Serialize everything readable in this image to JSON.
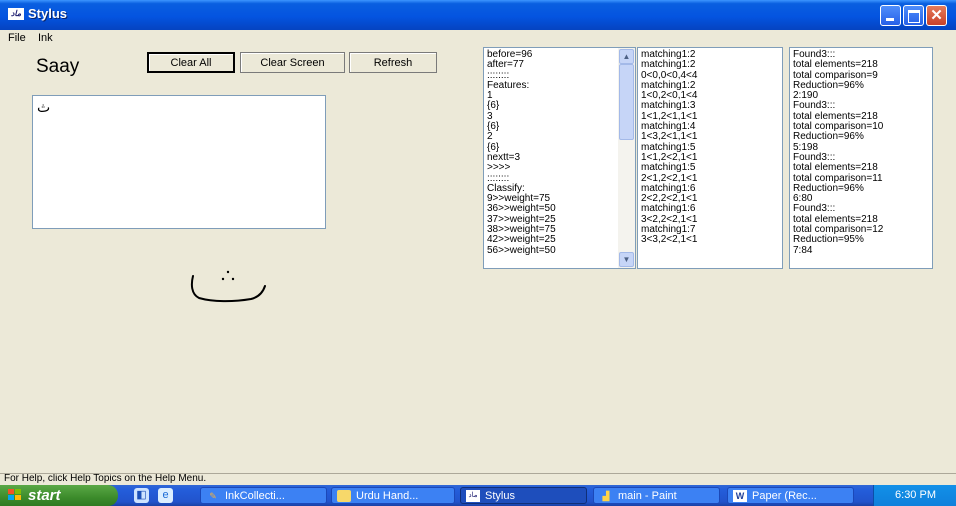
{
  "window": {
    "title": "Stylus",
    "icon_text": "ماد"
  },
  "menu": {
    "file": "File",
    "ink": "Ink"
  },
  "recognized_word": "Saay",
  "buttons": {
    "clear_all": "Clear All",
    "clear_screen": "Clear Screen",
    "refresh": "Refresh"
  },
  "canvas_glyph": "ث",
  "list1": {
    "lines": [
      "before=96",
      "after=77",
      "::::::::",
      "Features:",
      "1",
      "{6}",
      "3",
      "{6}",
      "2",
      "{6}",
      "nextt=3",
      ">>>>",
      "::::::::",
      "Classify:",
      "9>>weight=75",
      "36>>weight=50",
      "37>>weight=25",
      "38>>weight=75",
      "42>>weight=25",
      "56>>weight=50"
    ]
  },
  "list2": {
    "lines": [
      "matching1:2",
      "matching1:2",
      "0<0,0<0,4<4",
      "matching1:2",
      "1<0,2<0,1<4",
      "matching1:3",
      "1<1,2<1,1<1",
      "matching1:4",
      "1<3,2<1,1<1",
      "matching1:5",
      "1<1,2<2,1<1",
      "matching1:5",
      "2<1,2<2,1<1",
      "matching1:6",
      "2<2,2<2,1<1",
      "matching1:6",
      "3<2,2<2,1<1",
      "matching1:7",
      "3<3,2<2,1<1"
    ]
  },
  "list3": {
    "lines": [
      "Found3:::",
      "total elements=218",
      "total comparison=9",
      "Reduction=96%",
      "2:190",
      "Found3:::",
      "total elements=218",
      "total comparison=10",
      "Reduction=96%",
      "5:198",
      "Found3:::",
      "total elements=218",
      "total comparison=11",
      "Reduction=96%",
      "6:80",
      "Found3:::",
      "total elements=218",
      "total comparison=12",
      "Reduction=95%",
      "7:84"
    ]
  },
  "status_text": "For Help, click Help Topics on the Help Menu.",
  "taskbar": {
    "start": "start",
    "tasks": [
      {
        "label": "InkCollecti...",
        "icon": "ink-icon"
      },
      {
        "label": "Urdu Hand...",
        "icon": "folder-icon"
      },
      {
        "label": "Stylus",
        "icon": "stylus-app-icon",
        "active": true
      },
      {
        "label": "main - Paint",
        "icon": "paint-icon"
      },
      {
        "label": "Paper (Rec...",
        "icon": "word-icon"
      }
    ],
    "clock": "6:30 PM"
  }
}
